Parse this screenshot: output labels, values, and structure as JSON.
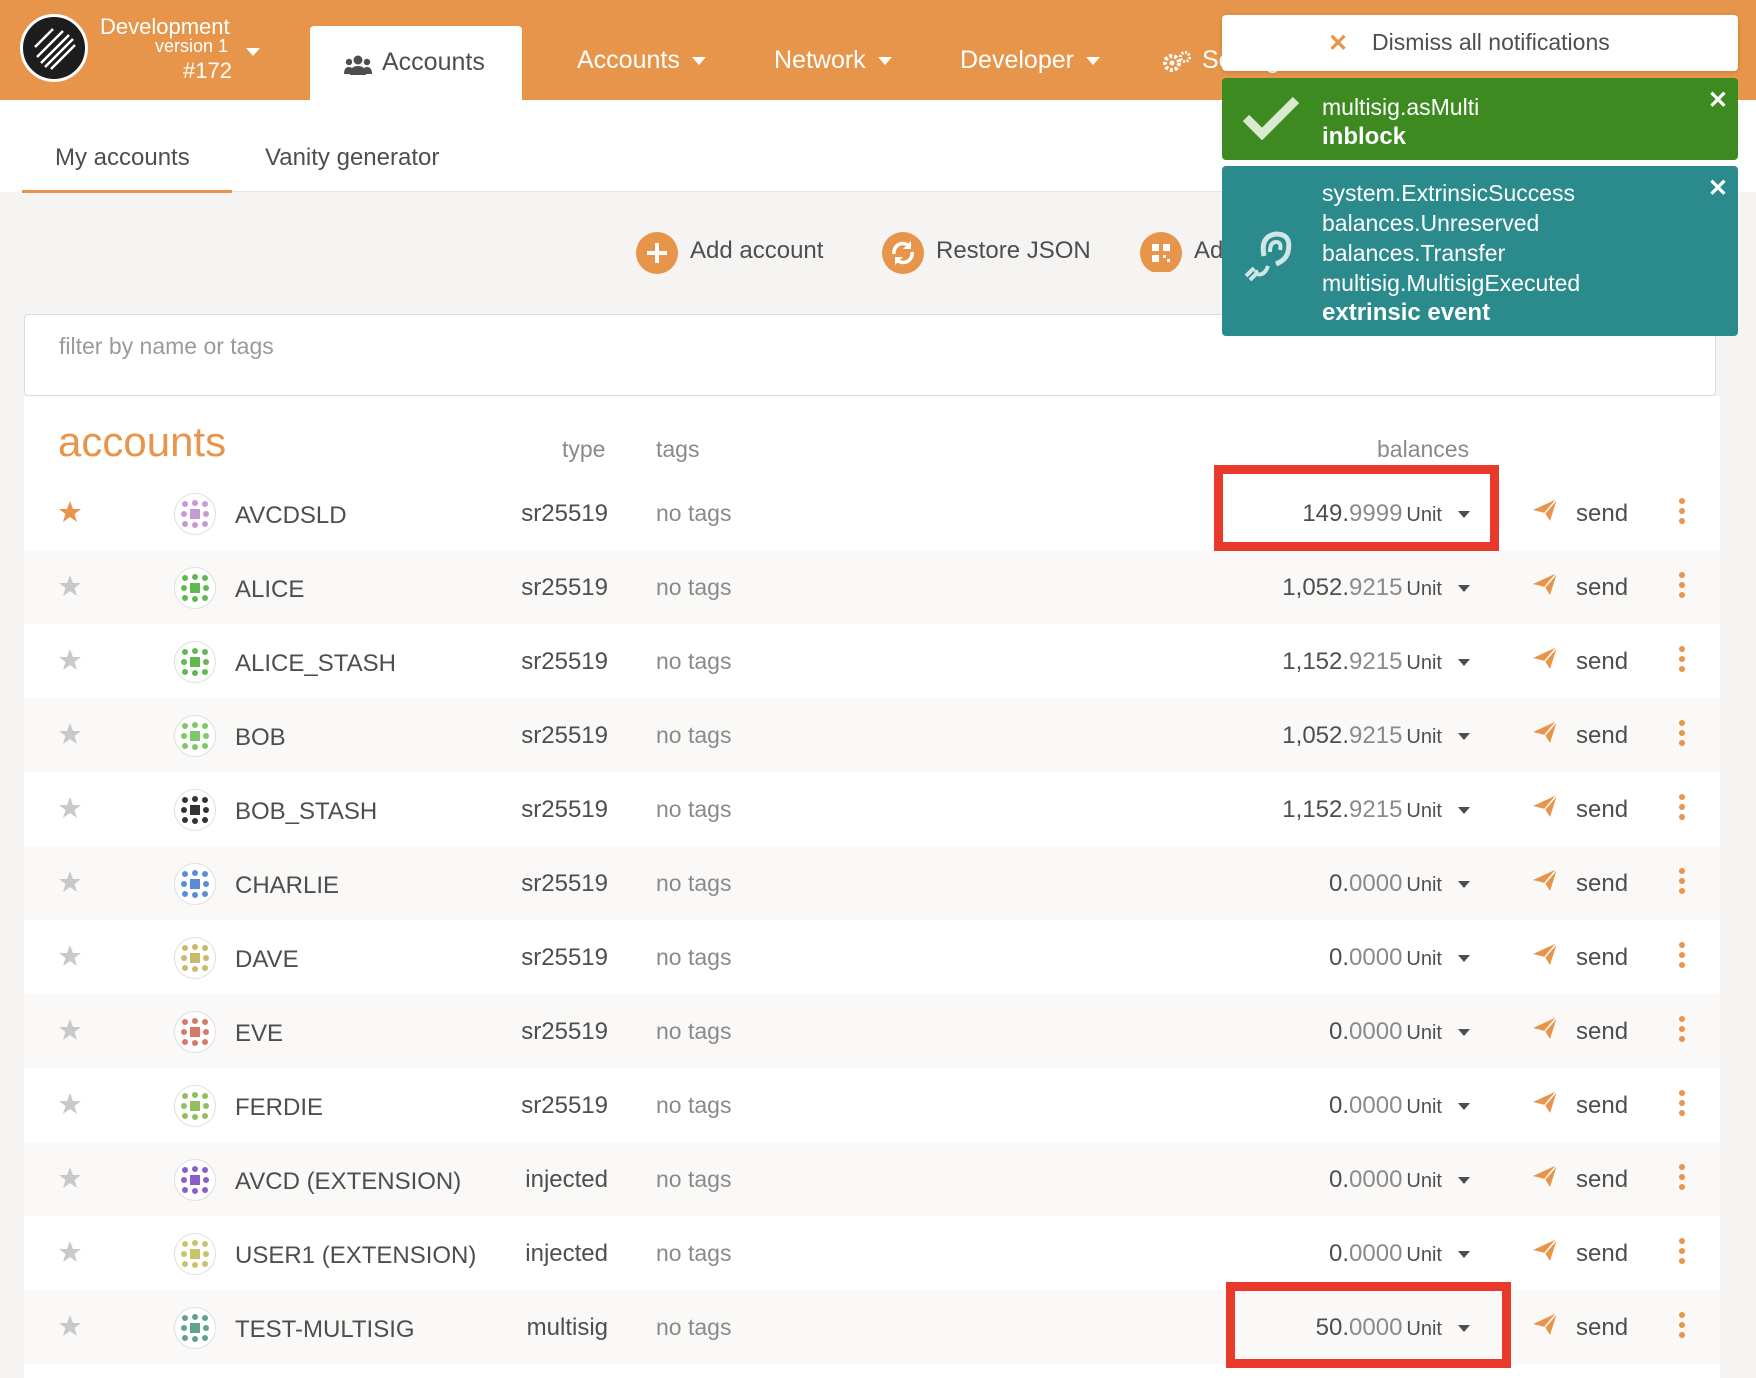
{
  "header": {
    "chain_name": "Development",
    "version": "version 1",
    "block": "#172",
    "active_tab": "Accounts",
    "menus": [
      "Accounts",
      "Network",
      "Developer",
      "Settings"
    ]
  },
  "subtabs": [
    "My accounts",
    "Vanity generator"
  ],
  "actions": [
    "Add account",
    "Restore JSON",
    "Add via QR"
  ],
  "filter": {
    "placeholder": "filter by name or tags"
  },
  "table": {
    "title": "accounts",
    "col_type": "type",
    "col_tags": "tags",
    "col_balances": "balances",
    "send_label": "send",
    "rows": [
      {
        "name": "AVCDSLD",
        "type": "sr25519",
        "tags": "no tags",
        "bal_int": "149.",
        "bal_dec": "9999",
        "unit": "Unit",
        "starred": true
      },
      {
        "name": "ALICE",
        "type": "sr25519",
        "tags": "no tags",
        "bal_int": "1,052.",
        "bal_dec": "9215",
        "unit": "Unit",
        "starred": false
      },
      {
        "name": "ALICE_STASH",
        "type": "sr25519",
        "tags": "no tags",
        "bal_int": "1,152.",
        "bal_dec": "9215",
        "unit": "Unit",
        "starred": false
      },
      {
        "name": "BOB",
        "type": "sr25519",
        "tags": "no tags",
        "bal_int": "1,052.",
        "bal_dec": "9215",
        "unit": "Unit",
        "starred": false
      },
      {
        "name": "BOB_STASH",
        "type": "sr25519",
        "tags": "no tags",
        "bal_int": "1,152.",
        "bal_dec": "9215",
        "unit": "Unit",
        "starred": false
      },
      {
        "name": "CHARLIE",
        "type": "sr25519",
        "tags": "no tags",
        "bal_int": "0.",
        "bal_dec": "0000",
        "unit": "Unit",
        "starred": false
      },
      {
        "name": "DAVE",
        "type": "sr25519",
        "tags": "no tags",
        "bal_int": "0.",
        "bal_dec": "0000",
        "unit": "Unit",
        "starred": false
      },
      {
        "name": "EVE",
        "type": "sr25519",
        "tags": "no tags",
        "bal_int": "0.",
        "bal_dec": "0000",
        "unit": "Unit",
        "starred": false
      },
      {
        "name": "FERDIE",
        "type": "sr25519",
        "tags": "no tags",
        "bal_int": "0.",
        "bal_dec": "0000",
        "unit": "Unit",
        "starred": false
      },
      {
        "name": "AVCD (EXTENSION)",
        "type": "injected",
        "tags": "no tags",
        "bal_int": "0.",
        "bal_dec": "0000",
        "unit": "Unit",
        "starred": false
      },
      {
        "name": "USER1 (EXTENSION)",
        "type": "injected",
        "tags": "no tags",
        "bal_int": "0.",
        "bal_dec": "0000",
        "unit": "Unit",
        "starred": false
      },
      {
        "name": "TEST-MULTISIG",
        "type": "multisig",
        "tags": "no tags",
        "bal_int": "50.",
        "bal_dec": "0000",
        "unit": "Unit",
        "starred": false
      }
    ]
  },
  "notifications": {
    "dismiss_all": "Dismiss all notifications",
    "n1": {
      "method": "multisig.asMulti",
      "status": "inblock"
    },
    "n2": {
      "events": [
        "system.ExtrinsicSuccess",
        "balances.Unreserved",
        "balances.Transfer",
        "multisig.MultisigExecuted"
      ],
      "status": "extrinsic event"
    }
  },
  "colors": {
    "accent": "#e6954a",
    "success": "#3d8a21",
    "event": "#2a8a8c",
    "highlight": "#e8392b"
  }
}
